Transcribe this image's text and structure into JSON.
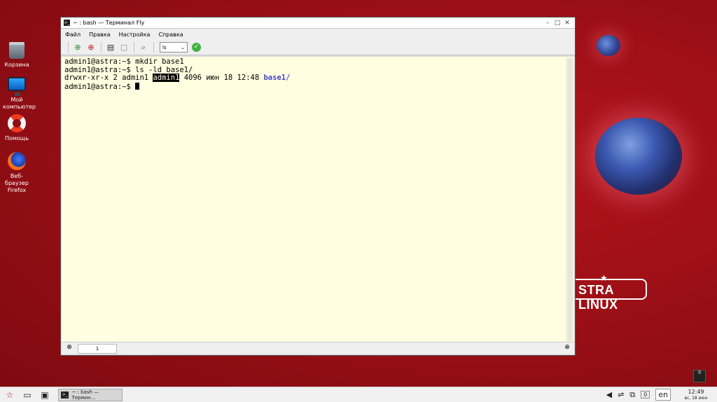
{
  "desktop": {
    "icons": [
      {
        "label": "Корзина"
      },
      {
        "label": "Мой компьютер"
      },
      {
        "label": "Помощь"
      },
      {
        "label": "Веб-браузер Firefox"
      }
    ],
    "brand": "STRA LINUX"
  },
  "window": {
    "title": "~ : bash — Терминал Fly",
    "menu": [
      "Файл",
      "Правка",
      "Настройка",
      "Справка"
    ],
    "toolbar": {
      "command_select": "ls",
      "icons": [
        "new-tab-icon",
        "new-window-icon",
        "copy-icon",
        "paste-icon",
        "search-icon",
        "run-icon"
      ]
    },
    "terminal": {
      "line1": "admin1@astra:~$ mkdir base1",
      "line2": "admin1@astra:~$ ls -ld base1/",
      "line3_prefix": "drwxr-xr-x 2 admin1 ",
      "line3_highlight": "admin1",
      "line3_middle": " 4096 июн 18 12:48 ",
      "line3_dir": "base1/",
      "line4": "admin1@astra:~$ "
    },
    "tabs": [
      {
        "label": "1"
      }
    ]
  },
  "taskbar": {
    "task_label": "~ : bash — Термин...",
    "lang": "en",
    "time": "12:49",
    "date": "вс, 18 июн",
    "tray_badge": "0"
  }
}
